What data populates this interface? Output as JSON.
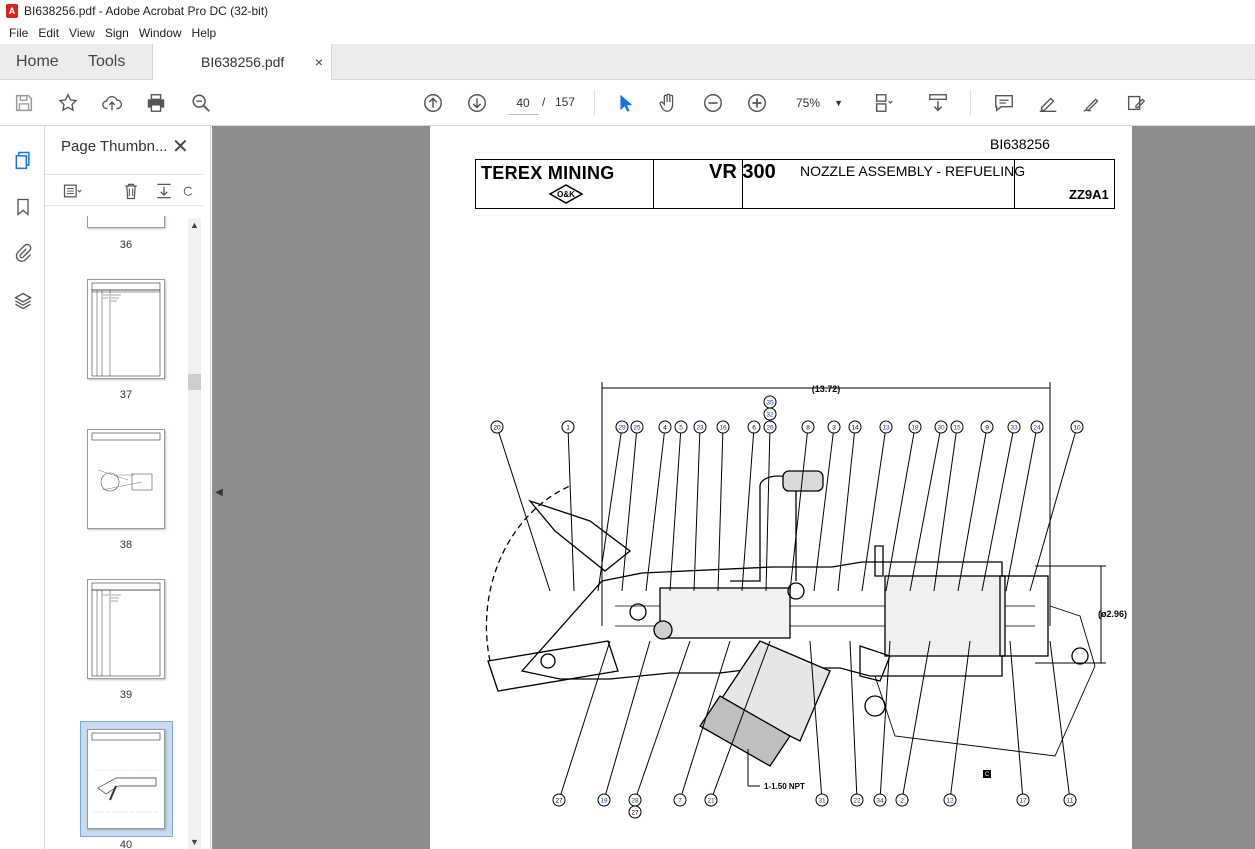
{
  "window": {
    "title": "BI638256.pdf - Adobe Acrobat Pro DC (32-bit)"
  },
  "menu": [
    "File",
    "Edit",
    "View",
    "Sign",
    "Window",
    "Help"
  ],
  "tabs": {
    "home": "Home",
    "tools": "Tools",
    "document": "BI638256.pdf",
    "close": "×"
  },
  "toolbar": {
    "current_page": "40",
    "page_sep": "/",
    "total_pages": "157",
    "zoom": "75%",
    "icons": [
      "save-icon",
      "bookmark-star-icon",
      "upload-cloud-icon",
      "print-icon",
      "search-zoom-icon",
      "arrow-up-circle-icon",
      "arrow-down-circle-icon",
      "select-cursor-icon",
      "hand-icon",
      "zoom-out-icon",
      "zoom-in-icon",
      "fit-page-icon",
      "scroll-mode-icon",
      "comment-icon",
      "highlight-pen-icon",
      "sign-icon",
      "more-tools-icon"
    ]
  },
  "panel": {
    "title": "Page Thumbn...",
    "close": "✕",
    "thumbnails": [
      {
        "label": "36"
      },
      {
        "label": "37"
      },
      {
        "label": "38"
      },
      {
        "label": "39"
      },
      {
        "label": "40",
        "selected": true
      }
    ]
  },
  "document": {
    "doc_id": "BI638256",
    "logo": "TEREX MINING",
    "logo_sub": "O&K",
    "model": "VR 300",
    "title": "NOZZLE ASSEMBLY - REFUELING",
    "code": "ZZ9A1",
    "dimension_length": "(13.72)",
    "dimension_dia": "(ø2.96)",
    "thread_label": "1-1.50 NPT",
    "callouts_top": [
      "20",
      "1",
      "29",
      "25",
      "4",
      "5",
      "23",
      "16",
      "6",
      "26",
      "8",
      "3",
      "14",
      "13",
      "18",
      "30",
      "15",
      "9",
      "33",
      "24",
      "10"
    ],
    "callouts_top_stack": [
      "35",
      "32"
    ],
    "callouts_bottom": [
      "27",
      "19",
      "28",
      "7",
      "21",
      "31",
      "22",
      "34",
      "2",
      "12",
      "17",
      "11"
    ],
    "callout_bottom_extra": "27",
    "square_marker": "C"
  }
}
